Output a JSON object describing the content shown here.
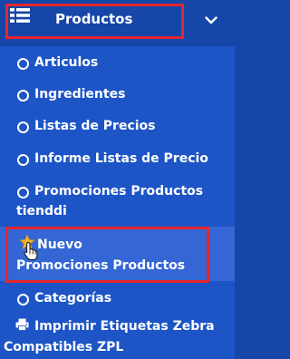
{
  "header": {
    "title": "Productos",
    "icon": "list-icon",
    "expand_icon": "chevron-down-icon"
  },
  "items": [
    {
      "label": "Articulos",
      "icon": "circle-icon"
    },
    {
      "label": "Ingredientes",
      "icon": "circle-icon"
    },
    {
      "label": "Listas de Precios",
      "icon": "circle-icon"
    },
    {
      "label": "Informe Listas de Precio",
      "icon": "circle-icon"
    },
    {
      "label_line1": "Promociones Productos",
      "label_line2": "tienddi",
      "icon": "circle-icon"
    },
    {
      "label_line1": "Nuevo",
      "label_line2": "Promociones Productos",
      "icon": "star-icon",
      "active": true
    },
    {
      "label": "Categorías",
      "icon": "circle-icon"
    },
    {
      "label_line1": "Imprimir Etiquetas Zebra",
      "label_line2": "Compatibles ZPL",
      "icon": "printer-icon"
    }
  ],
  "colors": {
    "header_bg": "#1546a8",
    "menu_bg": "#1d55c6",
    "active_bg": "#3466d5",
    "highlight_border": "#e5262d",
    "star": "#f2b234"
  }
}
